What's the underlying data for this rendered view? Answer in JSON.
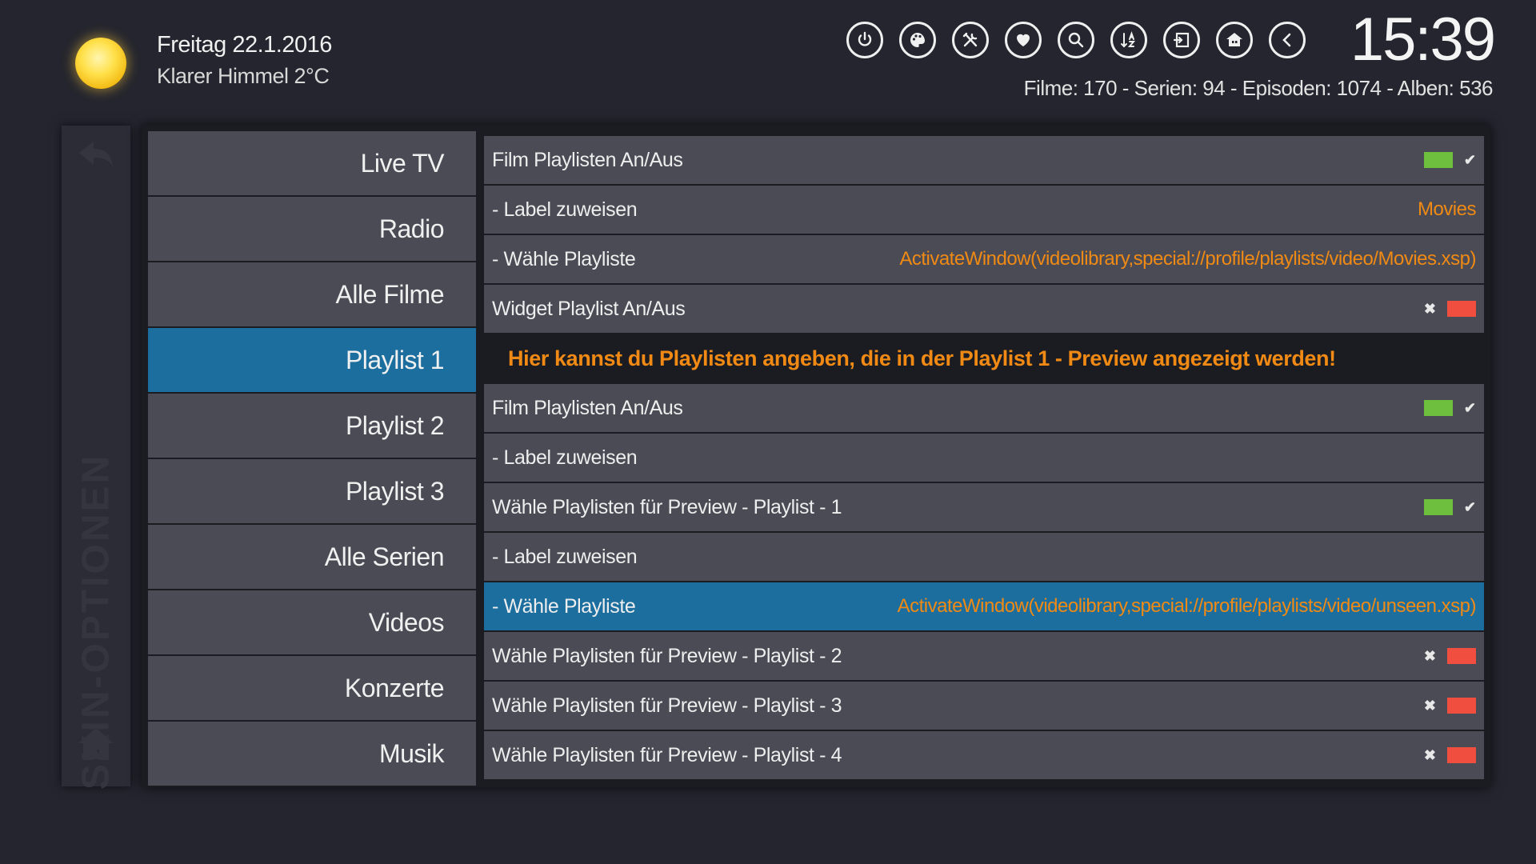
{
  "header": {
    "weather_date": "Freitag  22.1.2016",
    "weather_desc": "Klarer Himmel  2°C",
    "clock": "15:39",
    "library_stats": "Filme: 170 - Serien: 94 - Episoden: 1074 - Alben: 536",
    "icons": [
      "power-icon",
      "palette-icon",
      "tools-icon",
      "heart-icon",
      "search-icon",
      "sort-az-icon",
      "login-icon",
      "house-icon",
      "back-icon"
    ]
  },
  "sidebar": {
    "title": "SKIN-OPTIONEN"
  },
  "menu": {
    "items": [
      {
        "label": "Live TV"
      },
      {
        "label": "Radio"
      },
      {
        "label": "Alle Filme"
      },
      {
        "label": "Playlist 1"
      },
      {
        "label": "Playlist 2"
      },
      {
        "label": "Playlist 3"
      },
      {
        "label": "Alle Serien"
      },
      {
        "label": "Videos"
      },
      {
        "label": "Konzerte"
      },
      {
        "label": "Musik"
      }
    ],
    "selected": "Playlist 1"
  },
  "settings": {
    "rows": [
      {
        "label": "Film Playlisten An/Aus",
        "state": "on"
      },
      {
        "label": " - Label zuweisen",
        "value": "Movies"
      },
      {
        "label": "- Wähle Playliste",
        "value": "ActivateWindow(videolibrary,special://profile/playlists/video/Movies.xsp)"
      },
      {
        "label": "Widget Playlist An/Aus",
        "state": "off"
      },
      {
        "info": "Hier kannst du Playlisten angeben, die in der Playlist 1 - Preview angezeigt werden!"
      },
      {
        "label": "Film Playlisten An/Aus",
        "state": "on"
      },
      {
        "label": " - Label zuweisen",
        "value": ""
      },
      {
        "label": "Wähle Playlisten für Preview - Playlist - 1",
        "state": "on"
      },
      {
        "label": " - Label zuweisen",
        "value": ""
      },
      {
        "label": "- Wähle Playliste",
        "value": "ActivateWindow(videolibrary,special://profile/playlists/video/unseen.xsp)"
      },
      {
        "label": "Wähle Playlisten für Preview - Playlist - 2",
        "state": "off"
      },
      {
        "label": "Wähle Playlisten für Preview - Playlist - 3",
        "state": "off"
      },
      {
        "label": "Wähle Playlisten für Preview - Playlist - 4",
        "state": "off"
      }
    ],
    "focused_row": 9
  },
  "colors": {
    "background": "#24252e",
    "item": "#4a4b54",
    "highlight": "#1c6e9e",
    "value": "#f08a14",
    "on": "#6fbf3f",
    "off": "#f04e3e"
  }
}
